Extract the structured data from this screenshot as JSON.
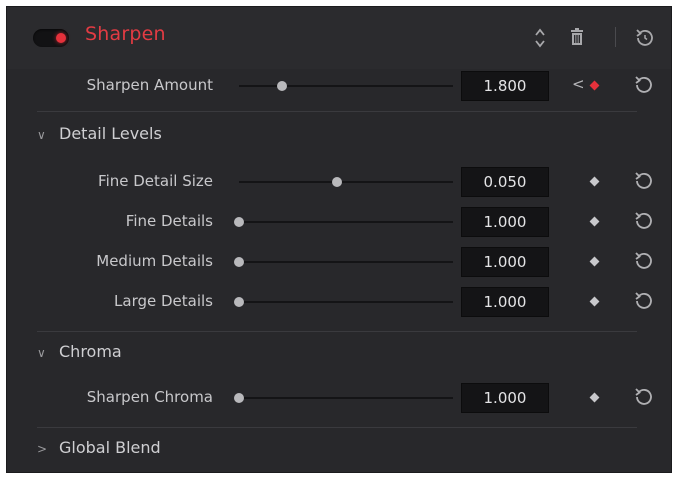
{
  "effect": {
    "title": "Sharpen",
    "enabled": true,
    "accent_color": "#e23b43"
  },
  "header_icons": [
    "reorder-arrows-icon",
    "trash-icon",
    "reset-all-icon"
  ],
  "sharpen_amount": {
    "label": "Sharpen Amount",
    "value": "1.800",
    "slider_fraction": 0.2,
    "keyframed": true
  },
  "detail_levels": {
    "title": "Detail Levels",
    "expanded": true,
    "rows": [
      {
        "label": "Fine Detail Size",
        "value": "0.050",
        "slider_fraction": 0.46
      },
      {
        "label": "Fine Details",
        "value": "1.000",
        "slider_fraction": 0.0
      },
      {
        "label": "Medium Details",
        "value": "1.000",
        "slider_fraction": 0.0
      },
      {
        "label": "Large Details",
        "value": "1.000",
        "slider_fraction": 0.0
      }
    ]
  },
  "chroma": {
    "title": "Chroma",
    "expanded": true,
    "rows": [
      {
        "label": "Sharpen Chroma",
        "value": "1.000",
        "slider_fraction": 0.0
      }
    ]
  },
  "global_blend": {
    "title": "Global Blend",
    "expanded": false
  }
}
